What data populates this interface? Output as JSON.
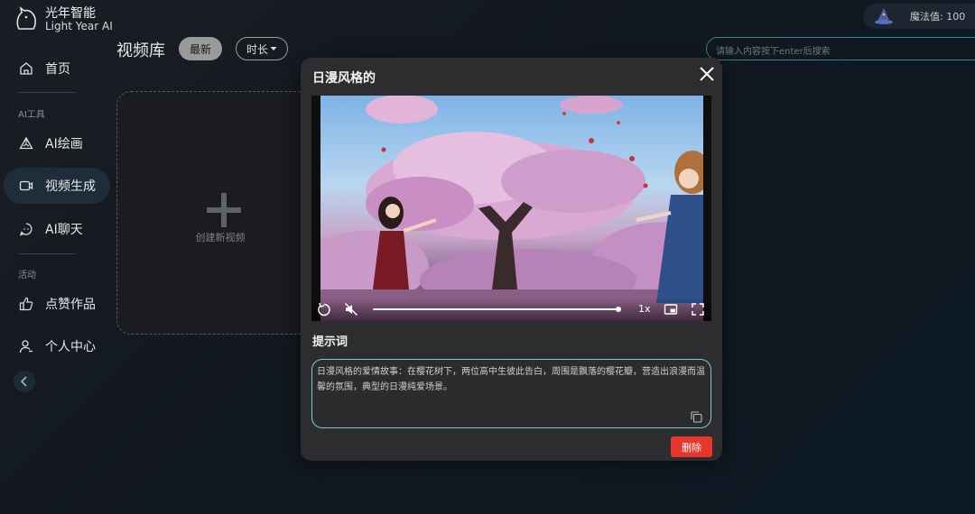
{
  "brand": {
    "name": "光年智能",
    "name_en": "Light Year AI"
  },
  "sidebar": {
    "items": [
      {
        "label": "首页",
        "icon": "home-icon"
      },
      {
        "label": "AI绘画",
        "icon": "triangle-icon"
      },
      {
        "label": "视频生成",
        "icon": "video-icon",
        "active": true
      },
      {
        "label": "AI聊天",
        "icon": "chat-icon"
      },
      {
        "label": "点赞作品",
        "icon": "thumbs-up-icon"
      },
      {
        "label": "个人中心",
        "icon": "user-icon"
      }
    ],
    "sections": {
      "ai_tools": "AI工具",
      "activity": "活动"
    }
  },
  "header": {
    "title": "视频库",
    "filter_newest": "最新",
    "filter_duration": "时长",
    "search_placeholder": "请输入内容按下enter后搜索",
    "magic_label": "魔法值:",
    "magic_value": "100"
  },
  "create_card": {
    "label": "创建新视频"
  },
  "modal": {
    "title": "日漫风格的",
    "video": {
      "speed": "1x",
      "progress": 1.0,
      "muted": true
    },
    "prompt_label": "提示词",
    "prompt_text": "日漫风格的爱情故事：在樱花树下，两位高中生彼此告白，周围是飘落的樱花瓣，营造出浪漫而温馨的氛围，典型的日漫纯爱场景。",
    "delete_label": "删除"
  },
  "colors": {
    "accent": "#7fc7d9",
    "active_bg": "#1f2d3a",
    "danger": "#e8362c"
  }
}
